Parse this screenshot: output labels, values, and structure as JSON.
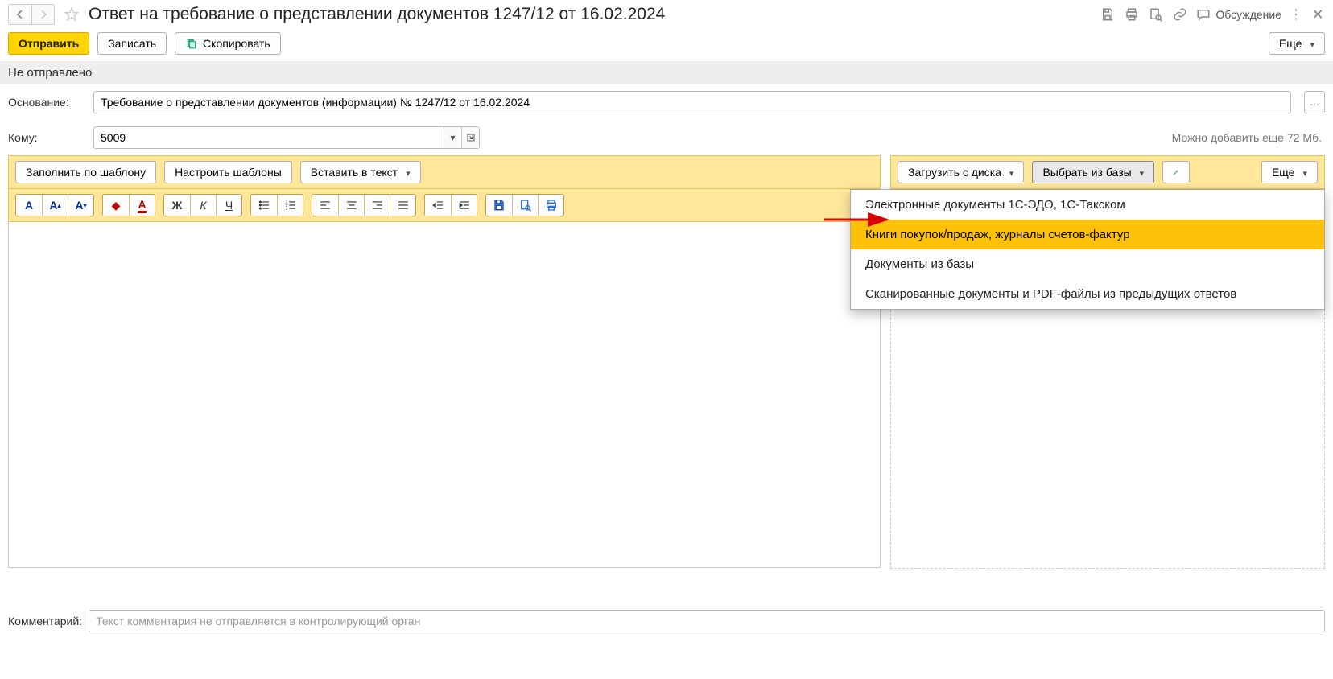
{
  "header": {
    "title": "Ответ на требование о представлении документов 1247/12 от 16.02.2024",
    "discussion": "Обсуждение"
  },
  "actions": {
    "send": "Отправить",
    "save": "Записать",
    "copy": "Скопировать",
    "more": "Еще"
  },
  "status": "Не отправлено",
  "form": {
    "basis_label": "Основание:",
    "basis_value": "Требование о представлении документов (информации) № 1247/12 от 16.02.2024",
    "to_label": "Кому:",
    "to_value": "5009",
    "quota_text": "Можно добавить еще 72 Мб."
  },
  "editor_toolbar": {
    "fill_template": "Заполнить по шаблону",
    "configure_templates": "Настроить шаблоны",
    "insert_text": "Вставить в текст"
  },
  "attachments": {
    "load_from_disk": "Загрузить с диска",
    "select_from_base": "Выбрать из базы",
    "more": "Еще",
    "menu": {
      "edo": "Электронные документы 1С-ЭДО, 1С-Такском",
      "books": "Книги покупок/продаж, журналы счетов-фактур",
      "docs": "Документы из базы",
      "scanned": "Сканированные документы и PDF-файлы из предыдущих ответов"
    }
  },
  "comment": {
    "label": "Комментарий:",
    "placeholder": "Текст комментария не отправляется в контролирующий орган"
  }
}
